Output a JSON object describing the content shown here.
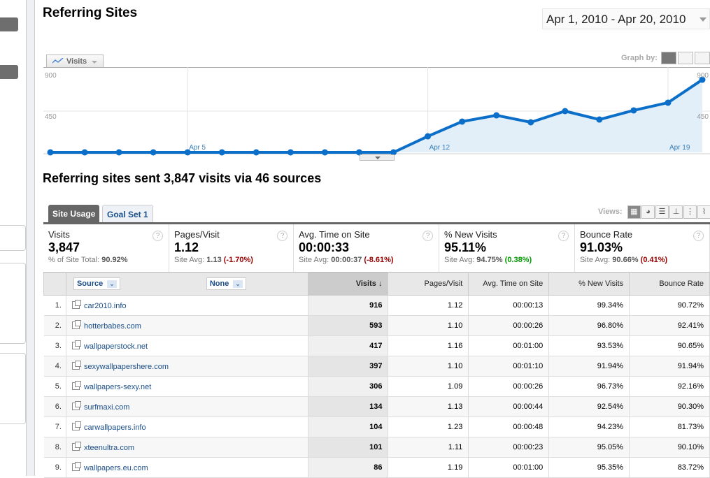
{
  "header": {
    "title": "Referring Sites",
    "date_range": "Apr 1, 2010 - Apr 20, 2010"
  },
  "graph": {
    "metric_button": "Visits",
    "graph_by_label": "Graph by:"
  },
  "chart_data": {
    "type": "area",
    "x": [
      "Apr 1",
      "Apr 2",
      "Apr 3",
      "Apr 4",
      "Apr 5",
      "Apr 6",
      "Apr 7",
      "Apr 8",
      "Apr 9",
      "Apr 10",
      "Apr 11",
      "Apr 12",
      "Apr 13",
      "Apr 14",
      "Apr 15",
      "Apr 16",
      "Apr 17",
      "Apr 18",
      "Apr 19",
      "Apr 20"
    ],
    "series": [
      {
        "name": "Visits",
        "values": [
          0,
          0,
          0,
          0,
          0,
          0,
          0,
          0,
          0,
          0,
          0,
          175,
          336,
          404,
          328,
          450,
          358,
          458,
          542,
          793
        ]
      }
    ],
    "yticks": [
      "900",
      "450"
    ],
    "xtick_labels": [
      "Apr 5",
      "Apr 12",
      "Apr 19"
    ],
    "ylim": [
      0,
      900
    ],
    "color": "#0b6ec9"
  },
  "summary": "Referring sites sent 3,847 visits via 46 sources",
  "tabs": [
    "Site Usage",
    "Goal Set 1"
  ],
  "views_label": "Views:",
  "metrics": [
    {
      "label": "Visits",
      "value": "3,847",
      "sub_prefix": "% of Site Total:",
      "sub_value": "90.92%",
      "delta": ""
    },
    {
      "label": "Pages/Visit",
      "value": "1.12",
      "sub_prefix": "Site Avg:",
      "sub_value": "1.13",
      "delta": "(-1.70%)"
    },
    {
      "label": "Avg. Time on Site",
      "value": "00:00:33",
      "sub_prefix": "Site Avg:",
      "sub_value": "00:00:37",
      "delta": "(-8.61%)"
    },
    {
      "label": "% New Visits",
      "value": "95.11%",
      "sub_prefix": "Site Avg:",
      "sub_value": "94.75%",
      "delta": "(0.38%)"
    },
    {
      "label": "Bounce Rate",
      "value": "91.03%",
      "sub_prefix": "Site Avg:",
      "sub_value": "90.66%",
      "delta": "(0.41%)"
    }
  ],
  "table": {
    "dimension": "Source",
    "secondary": "None",
    "columns": [
      "Visits ↓",
      "Pages/Visit",
      "Avg. Time on Site",
      "% New Visits",
      "Bounce Rate"
    ],
    "rows": [
      [
        "1.",
        "car2010.info",
        "916",
        "1.12",
        "00:00:13",
        "99.34%",
        "90.72%"
      ],
      [
        "2.",
        "hotterbabes.com",
        "593",
        "1.10",
        "00:00:26",
        "96.80%",
        "92.41%"
      ],
      [
        "3.",
        "wallpaperstock.net",
        "417",
        "1.16",
        "00:01:00",
        "93.53%",
        "90.65%"
      ],
      [
        "4.",
        "sexywallpapershere.com",
        "397",
        "1.10",
        "00:01:10",
        "91.94%",
        "91.94%"
      ],
      [
        "5.",
        "wallpapers-sexy.net",
        "306",
        "1.09",
        "00:00:26",
        "96.73%",
        "92.16%"
      ],
      [
        "6.",
        "surfmaxi.com",
        "134",
        "1.13",
        "00:00:44",
        "92.54%",
        "90.30%"
      ],
      [
        "7.",
        "carwallpapers.info",
        "104",
        "1.23",
        "00:00:48",
        "94.23%",
        "81.73%"
      ],
      [
        "8.",
        "xteenultra.com",
        "101",
        "1.11",
        "00:00:23",
        "95.05%",
        "90.10%"
      ],
      [
        "9.",
        "wallpapers.eu.com",
        "86",
        "1.19",
        "00:01:00",
        "95.35%",
        "83.72%"
      ]
    ]
  }
}
